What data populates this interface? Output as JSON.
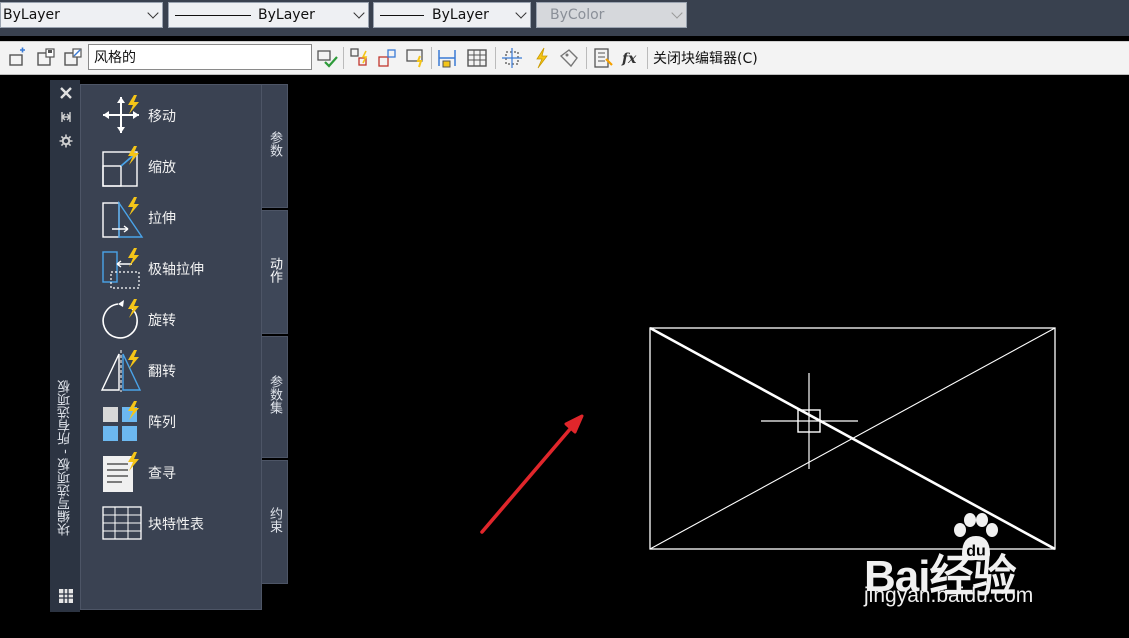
{
  "property_bar": {
    "layer_value": "ByLayer",
    "linetype_value": "ByLayer",
    "lineweight_value": "ByLayer",
    "color_value": "ByColor"
  },
  "block_toolbar": {
    "block_name": "风格的",
    "close_label": "关闭块编辑器(C)"
  },
  "palette": {
    "title": "块编写选项板 - 所有选项板",
    "items": [
      {
        "label": "移动"
      },
      {
        "label": "缩放"
      },
      {
        "label": "拉伸"
      },
      {
        "label": "极轴拉伸"
      },
      {
        "label": "旋转"
      },
      {
        "label": "翻转"
      },
      {
        "label": "阵列"
      },
      {
        "label": "查寻"
      },
      {
        "label": "块特性表"
      }
    ],
    "tabs": [
      {
        "label": "参数"
      },
      {
        "label": "动作"
      },
      {
        "label": "参数集"
      },
      {
        "label": "约束"
      }
    ],
    "active_tab": "动作"
  },
  "watermark": {
    "logo_text": "Bai经验",
    "url": "jingyan.baidu.com"
  },
  "colors": {
    "canvas": "#000000",
    "palette_bg": "#3a4252",
    "arrow": "#e0262b",
    "lightning": "#f5c518"
  }
}
